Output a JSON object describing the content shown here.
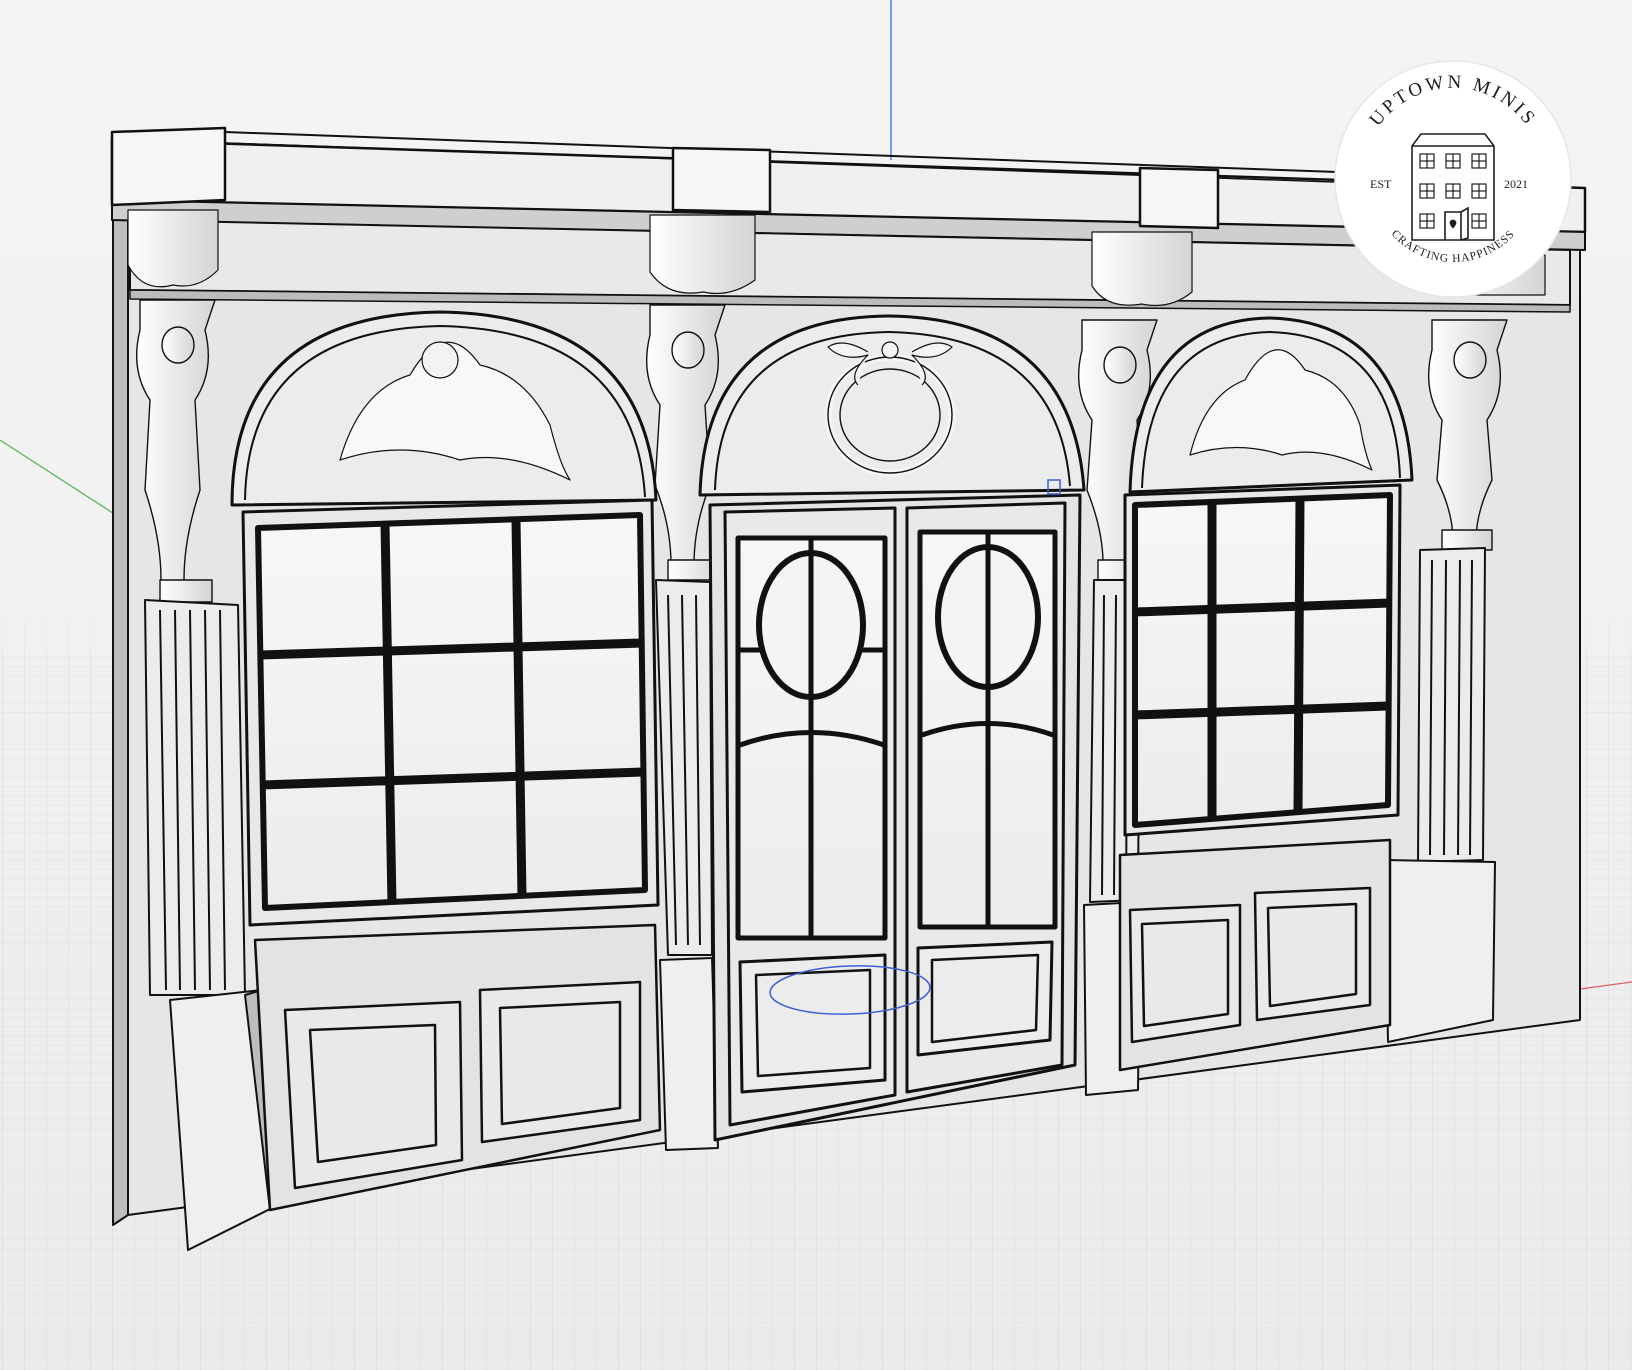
{
  "logo": {
    "brand_name": "UPTOWN MINIS",
    "est_label": "EST",
    "year": "2021",
    "tagline": "CRAFTING HAPPINESS",
    "house_icon": "townhouse-icon"
  },
  "colors": {
    "background": "#f2f2f2",
    "grid_line": "#d9d9d9",
    "model_fill": "#e3e3e3",
    "outline": "#111111",
    "axis_x": "#e06060",
    "axis_y": "#5ab55a",
    "axis_z": "#4a80e8",
    "selection": "#3a5fd6"
  }
}
